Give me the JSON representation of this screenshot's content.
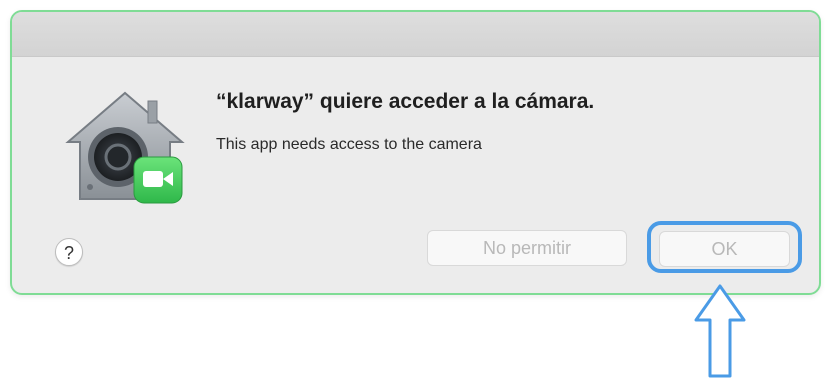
{
  "dialog": {
    "title": "“klarway” quiere acceder a la cámara.",
    "message": "This app needs access to the camera",
    "help_label": "?",
    "deny_label": "No permitir",
    "ok_label": "OK",
    "icon": "camera-privacy-icon"
  },
  "colors": {
    "dialog_border": "#7fdc95",
    "highlight": "#4a9be6"
  }
}
